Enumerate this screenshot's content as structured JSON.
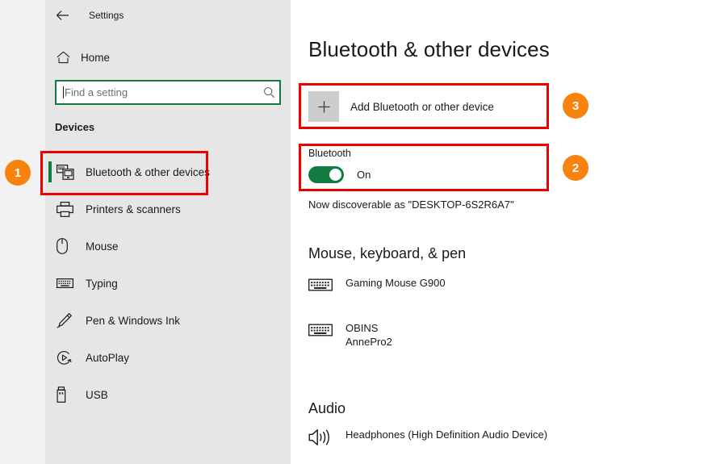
{
  "window": {
    "titlebar": {
      "label": "Settings",
      "back_icon": "back-arrow-icon"
    }
  },
  "sidebar": {
    "home": {
      "label": "Home",
      "icon": "home-icon"
    },
    "search": {
      "value": "",
      "placeholder": "Find a setting",
      "icon": "search-icon"
    },
    "group_title": "Devices",
    "accent_color": "#107c41",
    "background": "#e6e6e6",
    "items": [
      {
        "label": "Bluetooth & other devices",
        "icon": "bluetooth-devices-icon",
        "selected": true
      },
      {
        "label": "Printers & scanners",
        "icon": "printer-icon",
        "selected": false
      },
      {
        "label": "Mouse",
        "icon": "mouse-icon",
        "selected": false
      },
      {
        "label": "Typing",
        "icon": "keyboard-icon",
        "selected": false
      },
      {
        "label": "Pen & Windows Ink",
        "icon": "pen-icon",
        "selected": false
      },
      {
        "label": "AutoPlay",
        "icon": "autoplay-icon",
        "selected": false
      },
      {
        "label": "USB",
        "icon": "usb-icon",
        "selected": false
      }
    ]
  },
  "main": {
    "page_title": "Bluetooth & other devices",
    "add_device": {
      "label": "Add Bluetooth or other device",
      "icon": "plus-icon"
    },
    "bluetooth": {
      "header": "Bluetooth",
      "state": "On",
      "toggle_on": true,
      "toggle_color": "#107c41",
      "discoverable": "Now discoverable as \"DESKTOP-6S2R6A7\""
    },
    "sections": [
      {
        "heading": "Mouse, keyboard, & pen",
        "devices": [
          {
            "name": "Gaming Mouse G900",
            "sub": "",
            "icon": "keyboard-icon"
          },
          {
            "name": "OBINS",
            "sub": "AnnePro2",
            "icon": "keyboard-icon"
          }
        ]
      },
      {
        "heading": "Audio",
        "devices": [
          {
            "name": "Headphones (High Definition Audio Device)",
            "sub": "",
            "icon": "speaker-icon"
          }
        ]
      }
    ]
  },
  "annotations": {
    "box_color": "#ee0000",
    "badge_color": "#f7820d",
    "badges": [
      {
        "label": "1",
        "target": "sidebar-item-bluetooth-other-devices"
      },
      {
        "label": "2",
        "target": "bluetooth-toggle"
      },
      {
        "label": "3",
        "target": "add-device-button"
      }
    ]
  }
}
